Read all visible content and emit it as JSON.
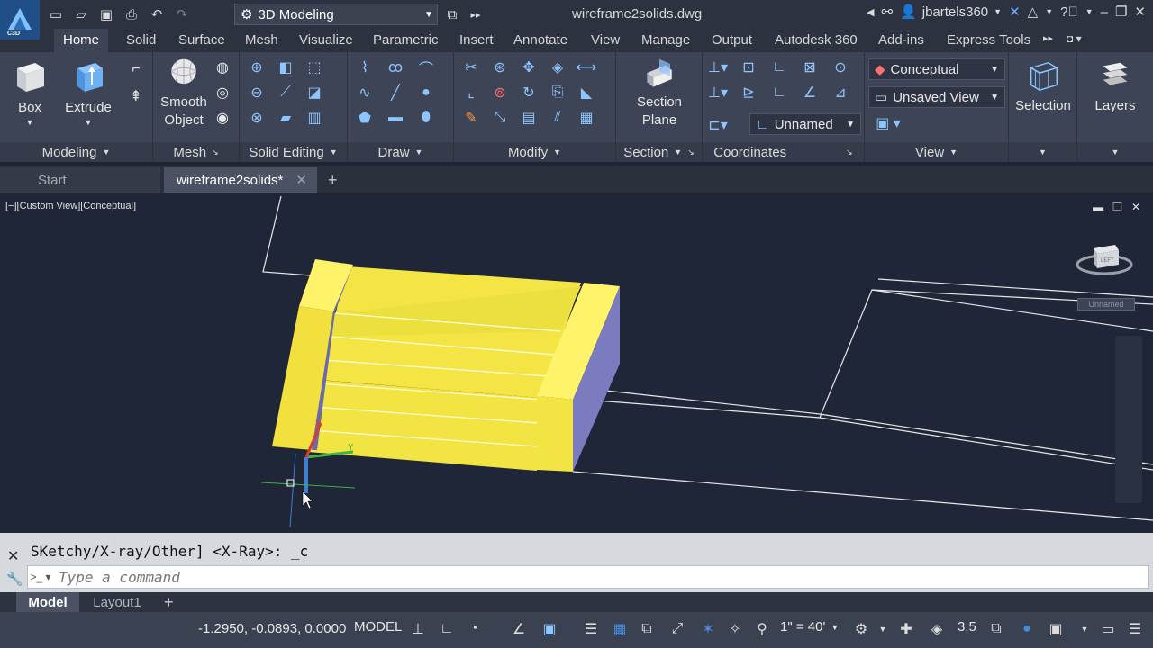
{
  "titlebar": {
    "app_badge": "C3D",
    "workspace": "3D Modeling",
    "filename": "wireframe2solids.dwg",
    "username": "jbartels360"
  },
  "ribbon_tabs": [
    "Home",
    "Solid",
    "Surface",
    "Mesh",
    "Visualize",
    "Parametric",
    "Insert",
    "Annotate",
    "View",
    "Manage",
    "Output",
    "Autodesk 360",
    "Add-ins",
    "Express Tools"
  ],
  "ribbon": {
    "modeling": {
      "title": "Modeling",
      "box": "Box",
      "extrude": "Extrude"
    },
    "mesh": {
      "title": "Mesh",
      "smooth_object_1": "Smooth",
      "smooth_object_2": "Object"
    },
    "solid_editing": {
      "title": "Solid Editing"
    },
    "draw": {
      "title": "Draw"
    },
    "modify": {
      "title": "Modify"
    },
    "section": {
      "title": "Section",
      "plane_1": "Section",
      "plane_2": "Plane"
    },
    "coordinates": {
      "title": "Coordinates",
      "ucs_named": "Unnamed"
    },
    "view": {
      "title": "View",
      "visual_style": "Conceptual",
      "named_view": "Unsaved View"
    },
    "selection": {
      "label": "Selection"
    },
    "layers": {
      "label": "Layers"
    }
  },
  "doc_tabs": {
    "start": "Start",
    "file": "wireframe2solids*"
  },
  "viewport": {
    "label": "[−][Custom View][Conceptual]",
    "viewcube_ucs": "Unnamed",
    "viewcube_face": "LEFT"
  },
  "command": {
    "history": "SKetchy/X-ray/Other] <X-Ray>: _c",
    "placeholder": "Type a command"
  },
  "layout_tabs": {
    "model": "Model",
    "layout1": "Layout1"
  },
  "statusbar": {
    "coords": "-1.2950, -0.0893, 0.0000",
    "space": "MODEL",
    "scale": "1\" = 40'",
    "annotation_value": "3.5"
  },
  "colors": {
    "accent": "#1f4f86",
    "solid_yellow": "#ffee33",
    "solid_side": "#7b7bc0",
    "viewport_bg": "#1f2637"
  }
}
